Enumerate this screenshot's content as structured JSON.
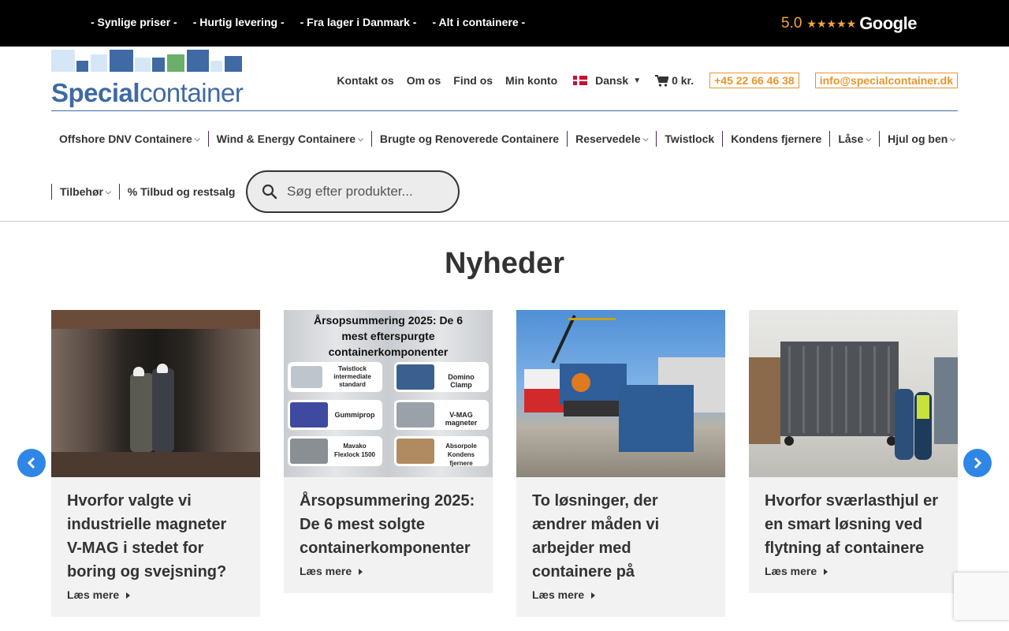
{
  "topbar": {
    "usps": [
      "- Synlige priser -",
      "- Hurtig levering -",
      "- Fra lager i Danmark -",
      "- Alt i containere -"
    ],
    "rating": "5.0",
    "stars": "★★★★★",
    "brand": "Google"
  },
  "logo": {
    "bold": "Special",
    "light": "container"
  },
  "topnav": {
    "links": [
      "Kontakt os",
      "Om os",
      "Find os",
      "Min konto"
    ],
    "language": "Dansk",
    "cart": "0 kr.",
    "phone": "+45 22 66 46 38",
    "email": "info@specialcontainer.dk"
  },
  "mainnav": {
    "row1": [
      "Offshore DNV Containere",
      "Wind & Energy Containere",
      "Brugte og Renoverede Containere",
      "Reservedele",
      "Twistlock",
      "Kondens fjernere",
      "Låse",
      "Hjul og ben"
    ],
    "row2": [
      "Tilbehør",
      "% Tilbud og restsalg"
    ]
  },
  "search": {
    "placeholder": "Søg efter produkter..."
  },
  "news": {
    "title": "Nyheder",
    "read_more": "Læs mere",
    "cards": [
      {
        "title": "Hvorfor valgte vi industrielle magneter V-MAG i stedet for boring og svejsning?"
      },
      {
        "title": "Årsopsummering 2025: De 6 mest solgte containerkomponenter",
        "image_text": {
          "heading": "Årsopsummering 2025: De 6 mest efterspurgte containerkomponenter",
          "items": [
            "Twistlock intermediate standard",
            "Domino Clamp",
            "Gummiprop",
            "V-MAG magneter",
            "Mavako Flexlock 1500",
            "Absorpole Kondens fjernere"
          ]
        }
      },
      {
        "title": "To løsninger, der ændrer måden vi arbejder med containere på"
      },
      {
        "title": "Hvorfor sværlasthjul er en smart løsning ved flytning af containere"
      }
    ]
  },
  "colors": {
    "brand_blue": "#3f6aa3",
    "accent_orange": "#e8952c",
    "arrow_blue": "#2f86e6"
  }
}
